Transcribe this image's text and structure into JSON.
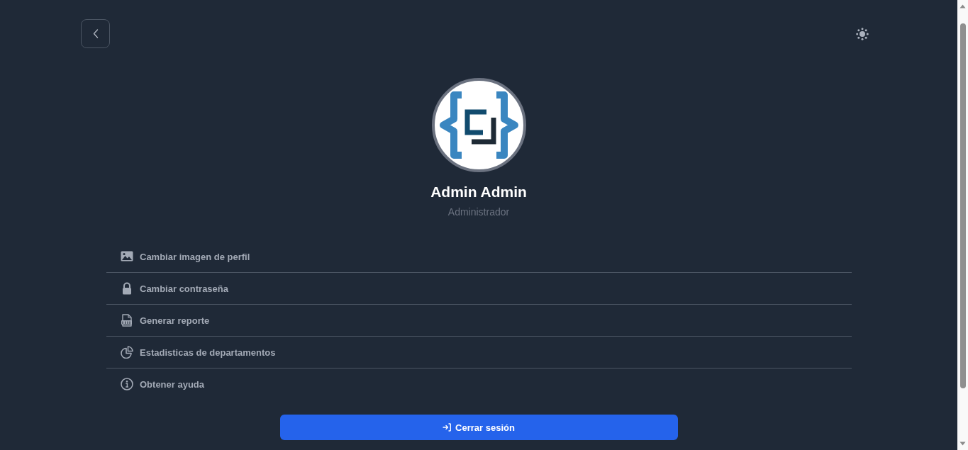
{
  "profile": {
    "name": "Admin Admin",
    "role": "Administrador"
  },
  "menu": [
    {
      "label": "Cambiar imagen de perfil"
    },
    {
      "label": "Cambiar contraseña"
    },
    {
      "label": "Generar reporte"
    },
    {
      "label": "Estadisticas de departamentos"
    },
    {
      "label": "Obtener ayuda"
    }
  ],
  "logout_button": {
    "label": "Cerrar sesión"
  }
}
